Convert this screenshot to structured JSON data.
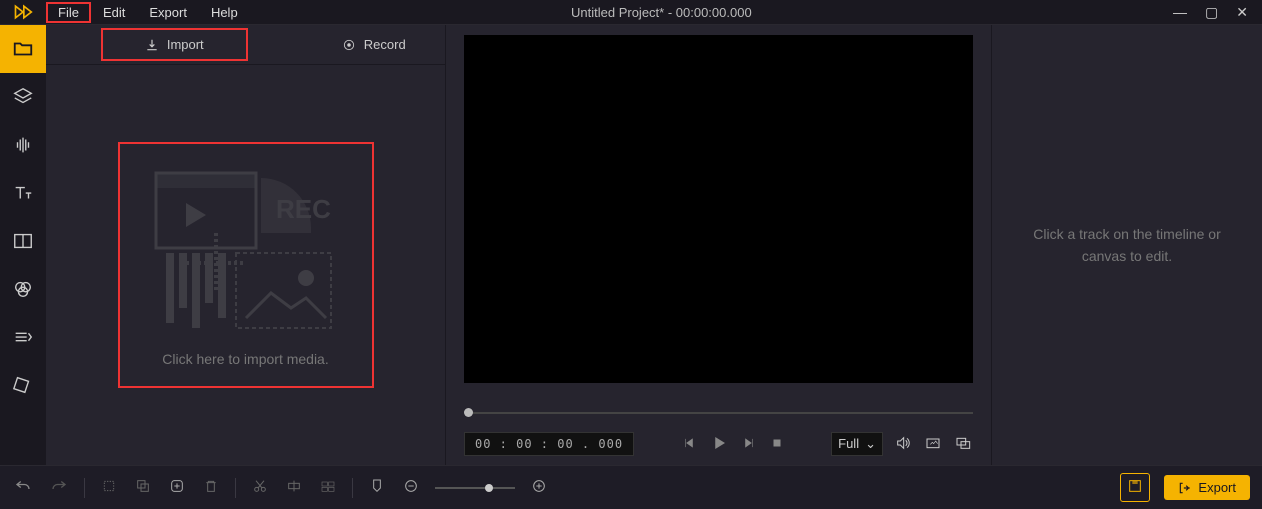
{
  "menu": {
    "file": "File",
    "edit": "Edit",
    "export": "Export",
    "help": "Help"
  },
  "title": "Untitled Project* - 00:00:00.000",
  "tabs": {
    "import": "Import",
    "record": "Record"
  },
  "drop": {
    "text": "Click here to import media."
  },
  "preview": {
    "timecode": "00 : 00 : 00 . 000",
    "fit": "Full"
  },
  "props": {
    "hint": "Click a track on the timeline or canvas to edit."
  },
  "bottom": {
    "export": "Export"
  },
  "colors": {
    "accent": "#f5b301",
    "highlight": "#e33",
    "bg": "#1a1820"
  }
}
